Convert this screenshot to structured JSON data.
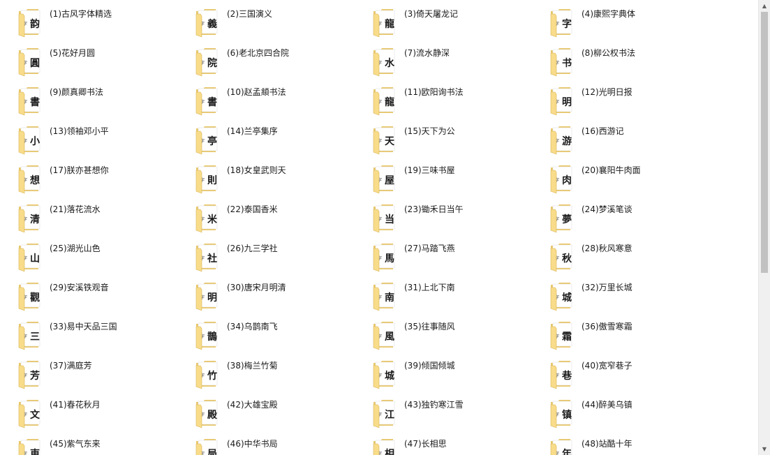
{
  "folders": [
    {
      "label": "(1)古风字体精选",
      "glyph": "韵"
    },
    {
      "label": "(2)三国演义",
      "glyph": "義"
    },
    {
      "label": "(3)倚天屠龙记",
      "glyph": "龍"
    },
    {
      "label": "(4)康熙字典体",
      "glyph": "字"
    },
    {
      "label": "(5)花好月圆",
      "glyph": "圓"
    },
    {
      "label": "(6)老北京四合院",
      "glyph": "院"
    },
    {
      "label": "(7)流水静深",
      "glyph": "水"
    },
    {
      "label": "(8)柳公权书法",
      "glyph": "书"
    },
    {
      "label": "(9)颜真卿书法",
      "glyph": "書"
    },
    {
      "label": "(10)赵孟頫书法",
      "glyph": "書"
    },
    {
      "label": "(11)欧阳询书法",
      "glyph": "龍"
    },
    {
      "label": "(12)光明日报",
      "glyph": "明"
    },
    {
      "label": "(13)领袖邓小平",
      "glyph": "小"
    },
    {
      "label": "(14)兰亭集序",
      "glyph": "亭"
    },
    {
      "label": "(15)天下为公",
      "glyph": "天"
    },
    {
      "label": "(16)西游记",
      "glyph": "游"
    },
    {
      "label": "(17)朕亦甚想你",
      "glyph": "想"
    },
    {
      "label": "(18)女皇武则天",
      "glyph": "則"
    },
    {
      "label": "(19)三味书屋",
      "glyph": "屋"
    },
    {
      "label": "(20)襄阳牛肉面",
      "glyph": "肉"
    },
    {
      "label": "(21)落花流水",
      "glyph": "清"
    },
    {
      "label": "(22)泰国香米",
      "glyph": "米"
    },
    {
      "label": "(23)锄禾日当午",
      "glyph": "当"
    },
    {
      "label": "(24)梦溪笔谈",
      "glyph": "夢"
    },
    {
      "label": "(25)湖光山色",
      "glyph": "山"
    },
    {
      "label": "(26)九三学社",
      "glyph": "社"
    },
    {
      "label": "(27)马踏飞燕",
      "glyph": "馬"
    },
    {
      "label": "(28)秋风寒意",
      "glyph": "秋"
    },
    {
      "label": "(29)安溪铁观音",
      "glyph": "觀"
    },
    {
      "label": "(30)唐宋月明清",
      "glyph": "明"
    },
    {
      "label": "(31)上北下南",
      "glyph": "南"
    },
    {
      "label": "(32)万里长城",
      "glyph": "城"
    },
    {
      "label": "(33)易中天品三国",
      "glyph": "三"
    },
    {
      "label": "(34)乌鹊南飞",
      "glyph": "鵲"
    },
    {
      "label": "(35)往事随风",
      "glyph": "風"
    },
    {
      "label": "(36)傲雪寒霜",
      "glyph": "霜"
    },
    {
      "label": "(37)满庭芳",
      "glyph": "芳"
    },
    {
      "label": "(38)梅兰竹菊",
      "glyph": "竹"
    },
    {
      "label": "(39)倾国倾城",
      "glyph": "城"
    },
    {
      "label": "(40)宽窄巷子",
      "glyph": "巷"
    },
    {
      "label": "(41)春花秋月",
      "glyph": "文"
    },
    {
      "label": "(42)大雄宝殿",
      "glyph": "殿"
    },
    {
      "label": "(43)独钓寒江雪",
      "glyph": "江"
    },
    {
      "label": "(44)醉美乌镇",
      "glyph": "镇"
    },
    {
      "label": "(45)紫气东来",
      "glyph": "東"
    },
    {
      "label": "(46)中华书局",
      "glyph": "局"
    },
    {
      "label": "(47)长相思",
      "glyph": "相"
    },
    {
      "label": "(48)站酷十年",
      "glyph": "年"
    }
  ],
  "colors": {
    "folder_back": "#e8c76a",
    "folder_front": "#f8dc8a",
    "folder_edge": "#d9b557",
    "paper": "#ffffff",
    "ink": "#1a1a1a",
    "scroll_track": "#f0f0f0",
    "scroll_thumb": "#c1c1c1"
  },
  "scrollbar": {
    "up_icon": "chevron-up-icon",
    "down_icon": "chevron-down-icon"
  }
}
